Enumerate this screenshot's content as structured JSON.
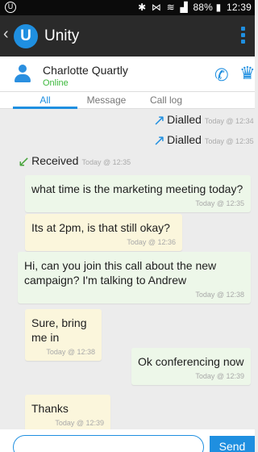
{
  "status_bar": {
    "left_icon": "unity-circle-icon",
    "left_glyph": "U",
    "battery": "88%",
    "time": "12:39"
  },
  "app_bar": {
    "title": "Unity",
    "logo_letter": "U",
    "back_glyph": "‹"
  },
  "contact": {
    "name": "Charlotte Quartly",
    "status": "Online"
  },
  "tabs": [
    {
      "label": "All",
      "active": true
    },
    {
      "label": "Message",
      "active": false
    },
    {
      "label": "Call log",
      "active": false
    }
  ],
  "timeline": [
    {
      "kind": "call",
      "direction": "out",
      "label": "Dialled",
      "time": "Today @ 12:34"
    },
    {
      "kind": "call",
      "direction": "out",
      "label": "Dialled",
      "time": "Today @ 12:35"
    },
    {
      "kind": "call",
      "direction": "in",
      "label": "Received",
      "time": "Today @ 12:35"
    },
    {
      "kind": "msg",
      "from": "me",
      "text": "what time is the marketing meeting today?",
      "time": "Today @ 12:35"
    },
    {
      "kind": "msg",
      "from": "them",
      "text": "Its at 2pm, is that still okay?",
      "time": "Today @ 12:36"
    },
    {
      "kind": "msg",
      "from": "me",
      "text": "Hi, can you join this call about the new campaign? I'm talking to Andrew",
      "time": "Today @ 12:38"
    },
    {
      "kind": "msg",
      "from": "them",
      "text": "Sure, bring me in",
      "time": "Today @ 12:38"
    },
    {
      "kind": "msg",
      "from": "me",
      "text": "Ok conferencing now",
      "time": "Today @ 12:39"
    },
    {
      "kind": "msg",
      "from": "them",
      "text": "Thanks",
      "time": "Today @ 12:39"
    }
  ],
  "composer": {
    "placeholder": "",
    "send_label": "Send"
  },
  "colors": {
    "accent": "#1f8fe0",
    "received_call": "#46a33a",
    "online": "#3cb83c",
    "incoming_bubble": "#fbf6dc",
    "outgoing_bubble": "#edf7e9"
  }
}
